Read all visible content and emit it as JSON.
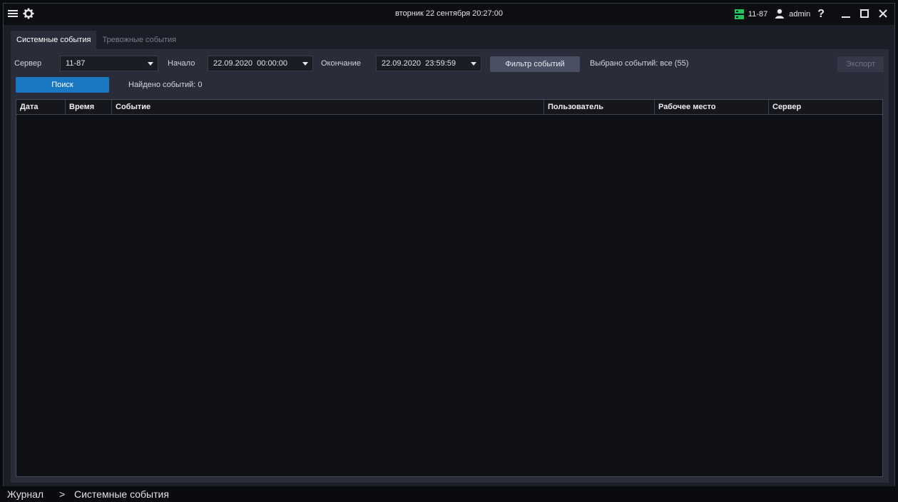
{
  "titlebar": {
    "datetime": "вторник 22 сентября 20:27:00",
    "server_name": "11-87",
    "user_name": "admin",
    "help_glyph": "?",
    "icons": [
      "menu-icon",
      "gear-icon",
      "server-icon",
      "user-icon",
      "help-icon",
      "minimize-icon",
      "maximize-icon",
      "close-icon"
    ]
  },
  "tabs": [
    {
      "label": "Системные события",
      "active": true
    },
    {
      "label": "Тревожные события",
      "active": false
    }
  ],
  "filters": {
    "server_label": "Сервер",
    "server_value": "11-87",
    "start_label": "Начало",
    "start_value": "22.09.2020  00:00:00",
    "end_label": "Окончание",
    "end_value": "22.09.2020  23:59:59",
    "filter_button": "Фильтр событий",
    "selected_events": "Выбрано событий: все (55)",
    "export_button": "Экспорт",
    "search_button": "Поиск",
    "found_events": "Найдено событий: 0"
  },
  "table": {
    "columns": [
      "Дата",
      "Время",
      "Событие",
      "Пользователь",
      "Рабочее место",
      "Сервер"
    ],
    "rows": []
  },
  "breadcrumb": {
    "root": "Журнал",
    "separator": ">",
    "current": "Системные события"
  },
  "colors": {
    "accent": "#1a78c2",
    "server_status": "#22c55e",
    "background": "#1c1e27"
  }
}
